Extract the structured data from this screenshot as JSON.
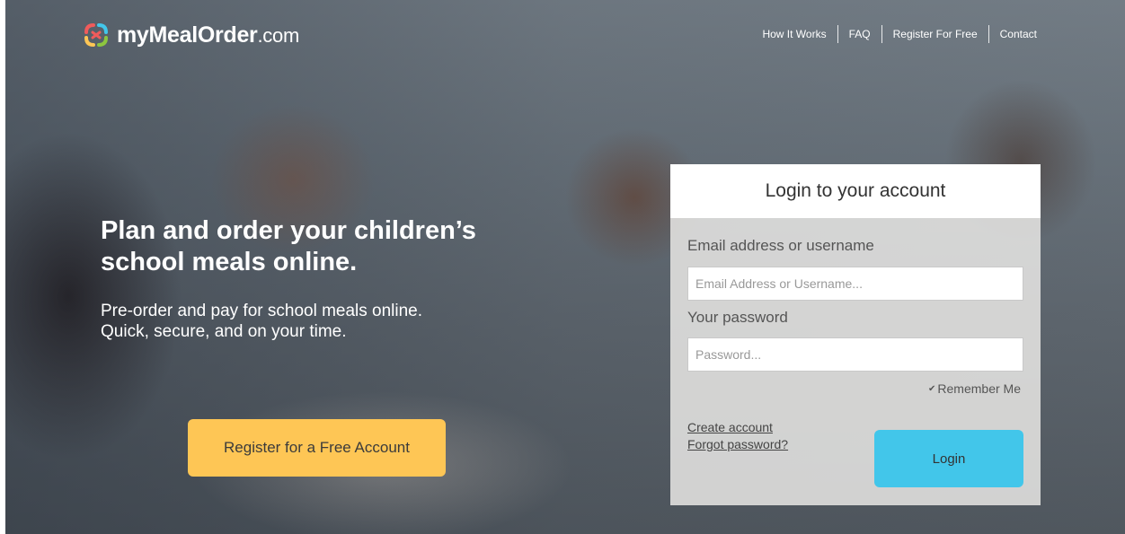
{
  "brand": {
    "name_main": "myMealOrder",
    "name_suffix": ".com",
    "icon": "logo-links-icon",
    "colors": [
      "#f05b5b",
      "#fec655",
      "#42c6ea",
      "#8dc63f"
    ]
  },
  "nav": {
    "items": [
      "How It Works",
      "FAQ",
      "Register For Free",
      "Contact"
    ]
  },
  "hero": {
    "headline": "Plan and order your children’s school meals online.",
    "subline_1": "Pre-order and pay for school meals online.",
    "subline_2": "Quick, secure, and on your time.",
    "register_button": "Register for a Free Account",
    "register_color": "#fec655"
  },
  "login": {
    "title": "Login to your account",
    "email_label": "Email address or username",
    "email_placeholder": "Email Address or Username...",
    "password_label": "Your password",
    "password_placeholder": "Password...",
    "remember_label": "Remember Me",
    "remember_checked": true,
    "create_account": "Create account",
    "forgot_password": "Forgot password?",
    "login_button": "Login",
    "login_color": "#42c6ea"
  }
}
